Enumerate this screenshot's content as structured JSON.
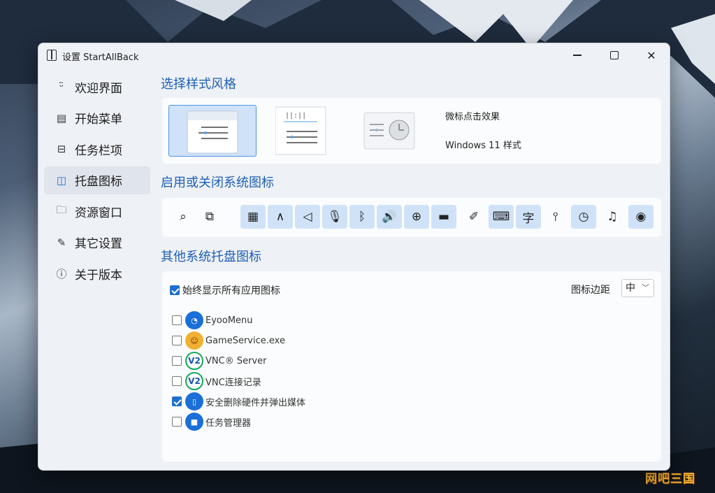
{
  "watermark": "网吧三国",
  "window": {
    "title": "设置 StartAllBack",
    "minimize": "—",
    "close": "✕"
  },
  "sidebar": {
    "items": [
      {
        "label": "欢迎界面",
        "icon": "smile-icon",
        "glyph": "ᵕ̈"
      },
      {
        "label": "开始菜单",
        "icon": "start-menu-icon",
        "glyph": "▤"
      },
      {
        "label": "任务栏项",
        "icon": "taskbar-icon",
        "glyph": "⊟"
      },
      {
        "label": "托盘图标",
        "icon": "tray-icon",
        "glyph": "◫"
      },
      {
        "label": "资源窗口",
        "icon": "folder-icon",
        "glyph": "🗀"
      },
      {
        "label": "其它设置",
        "icon": "wrench-icon",
        "glyph": "✎"
      },
      {
        "label": "关于版本",
        "icon": "info-icon",
        "glyph": "ⓘ"
      }
    ],
    "active_index": 3
  },
  "style_section": {
    "title": "选择样式风格",
    "desc1": "微标点击效果",
    "desc2": "Windows 11 样式"
  },
  "icons_section": {
    "title": "启用或关闭系统图标",
    "icons": [
      {
        "name": "search-icon",
        "glyph": "⌕",
        "on": false
      },
      {
        "name": "task-view-icon",
        "glyph": "⧉",
        "on": false
      },
      {
        "name": "widgets-icon",
        "glyph": "▦",
        "on": true
      },
      {
        "name": "chevron-up-icon",
        "glyph": "∧",
        "on": true
      },
      {
        "name": "location-icon",
        "glyph": "◁",
        "on": true
      },
      {
        "name": "microphone-icon",
        "glyph": "🎙",
        "on": true
      },
      {
        "name": "bluetooth-icon",
        "glyph": "ᛒ",
        "on": true
      },
      {
        "name": "volume-icon",
        "glyph": "🔊",
        "on": true
      },
      {
        "name": "globe-icon",
        "glyph": "⊕",
        "on": true
      },
      {
        "name": "battery-icon",
        "glyph": "▬",
        "on": true
      },
      {
        "name": "pen-icon",
        "glyph": "✐",
        "on": false
      },
      {
        "name": "keyboard-icon",
        "glyph": "⌨",
        "on": true
      },
      {
        "name": "language-icon",
        "glyph": "字",
        "on": true
      },
      {
        "name": "sliders-icon",
        "glyph": "⫯",
        "on": false
      },
      {
        "name": "clock-icon",
        "glyph": "◷",
        "on": true
      },
      {
        "name": "bell-icon",
        "glyph": "♫",
        "on": false
      },
      {
        "name": "eye-icon",
        "glyph": "◉",
        "on": true
      }
    ]
  },
  "other_section": {
    "title": "其他系统托盘图标",
    "show_all_label": "始终显示所有应用图标",
    "show_all_checked": true,
    "margin_label": "图标边距",
    "margin_value": "中",
    "apps": [
      {
        "label": "EyooMenu",
        "icon": "eyoomenu-icon",
        "glyph": "◔",
        "checked": false
      },
      {
        "label": "GameService.exe",
        "icon": "gameservice-icon",
        "glyph": "☺",
        "checked": false
      },
      {
        "label": "VNC® Server",
        "icon": "vnc-server-icon",
        "glyph": "V2",
        "checked": false
      },
      {
        "label": "VNC连接记录",
        "icon": "vnc-record-icon",
        "glyph": "V2",
        "checked": false
      },
      {
        "label": "安全删除硬件并弹出媒体",
        "icon": "usb-eject-icon",
        "glyph": "▯",
        "checked": true
      },
      {
        "label": "任务管理器",
        "icon": "task-manager-icon",
        "glyph": "■",
        "checked": false
      }
    ]
  }
}
